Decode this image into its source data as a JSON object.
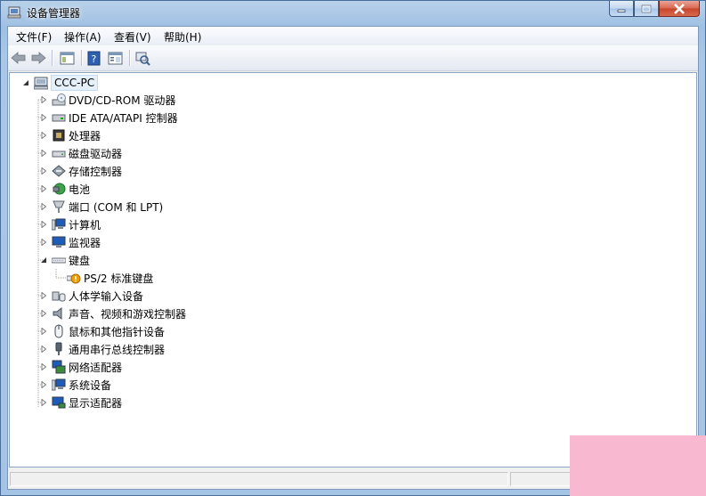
{
  "window": {
    "title": "设备管理器",
    "accent": "#a9c7e6"
  },
  "menubar": {
    "items": [
      "文件(F)",
      "操作(A)",
      "查看(V)",
      "帮助(H)"
    ]
  },
  "toolbar": {
    "buttons": [
      "back-icon",
      "forward-icon",
      "console-tree-icon",
      "help-icon",
      "properties-view-icon",
      "scan-hardware-icon"
    ]
  },
  "tree": {
    "root": "CCC-PC",
    "categories": [
      "DVD/CD-ROM 驱动器",
      "IDE ATA/ATAPI 控制器",
      "处理器",
      "磁盘驱动器",
      "存储控制器",
      "电池",
      "端口 (COM 和 LPT)",
      "计算机",
      "监视器",
      "键盘",
      "PS/2 标准键盘",
      "人体学输入设备",
      "声音、视频和游戏控制器",
      "鼠标和其他指针设备",
      "通用串行总线控制器",
      "网络适配器",
      "系统设备",
      "显示适配器"
    ],
    "warning_color": "#f0a000"
  },
  "statusbar": {
    "text": ""
  }
}
